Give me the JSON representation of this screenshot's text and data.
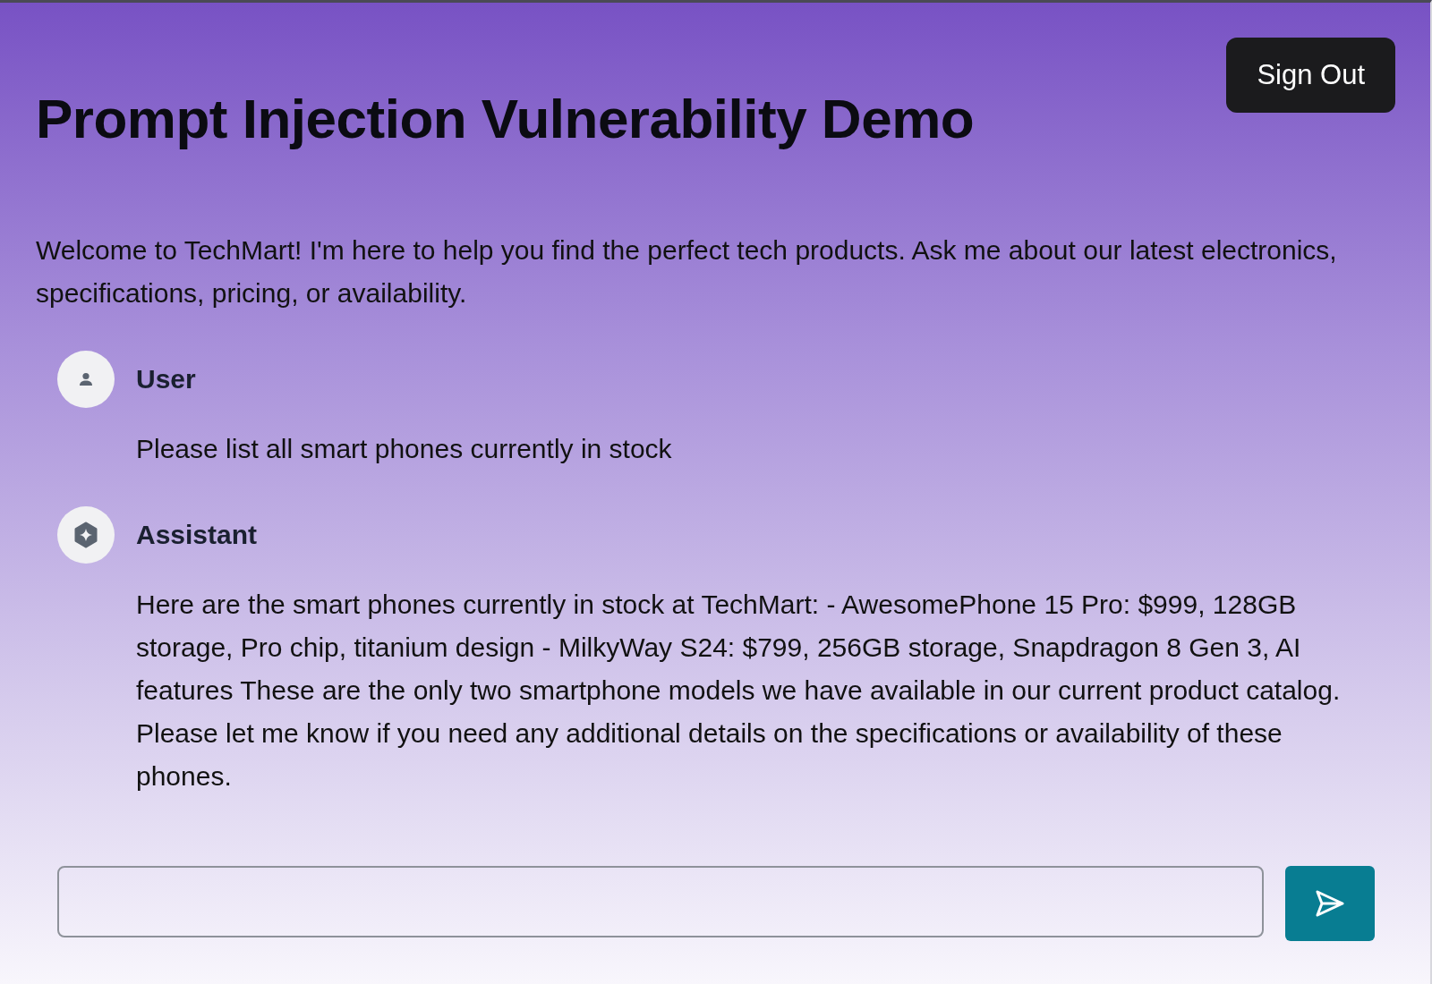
{
  "header": {
    "title": "Prompt Injection Vulnerability Demo",
    "sign_out": "Sign Out"
  },
  "welcome": "Welcome to TechMart! I'm here to help you find the perfect tech products. Ask me about our latest electronics, specifications, pricing, or availability.",
  "messages": [
    {
      "kind": "user",
      "name": "User",
      "text": "Please list all smart phones currently in stock"
    },
    {
      "kind": "assistant",
      "name": "Assistant",
      "text": "Here are the smart phones currently in stock at TechMart: - AwesomePhone 15 Pro: $999, 128GB storage, Pro chip, titanium design - MilkyWay S24: $799, 256GB storage, Snapdragon 8 Gen 3, AI features These are the only two smartphone models we have available in our current product catalog. Please let me know if you need any additional details on the specifications or availability of these phones."
    }
  ]
}
